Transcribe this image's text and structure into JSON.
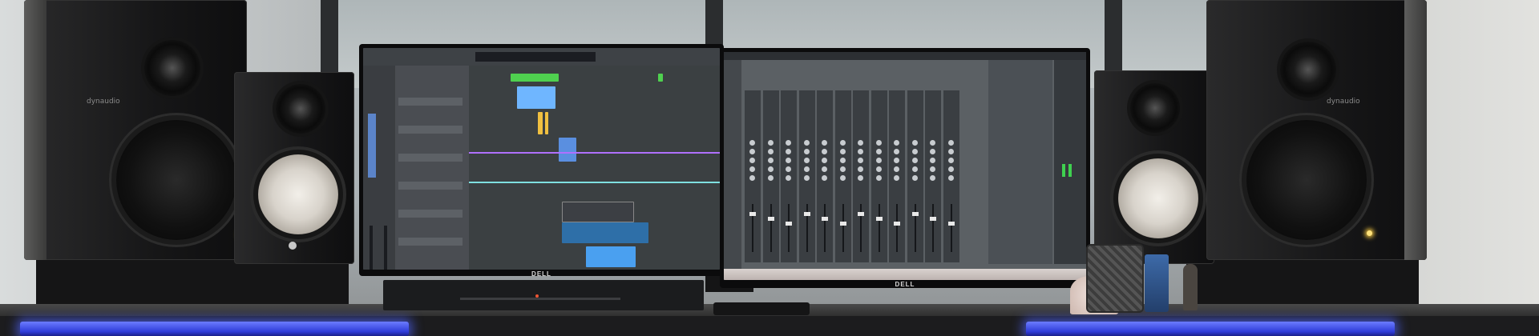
{
  "scene": "studio-desk",
  "speakers": {
    "brand_label": "dynaudio"
  },
  "monitors": {
    "left_brand": "DELL",
    "right_brand": "DELL"
  },
  "colors": {
    "led_strip": "#3a48ff",
    "daw_region_green": "#4fd14f",
    "daw_region_blue": "#5aa8ff",
    "daw_region_yellow": "#f0c040",
    "daw_line_purple": "#b070ff",
    "daw_line_cyan": "#7fe0e0",
    "dock_pink": "#d9c8c4"
  }
}
